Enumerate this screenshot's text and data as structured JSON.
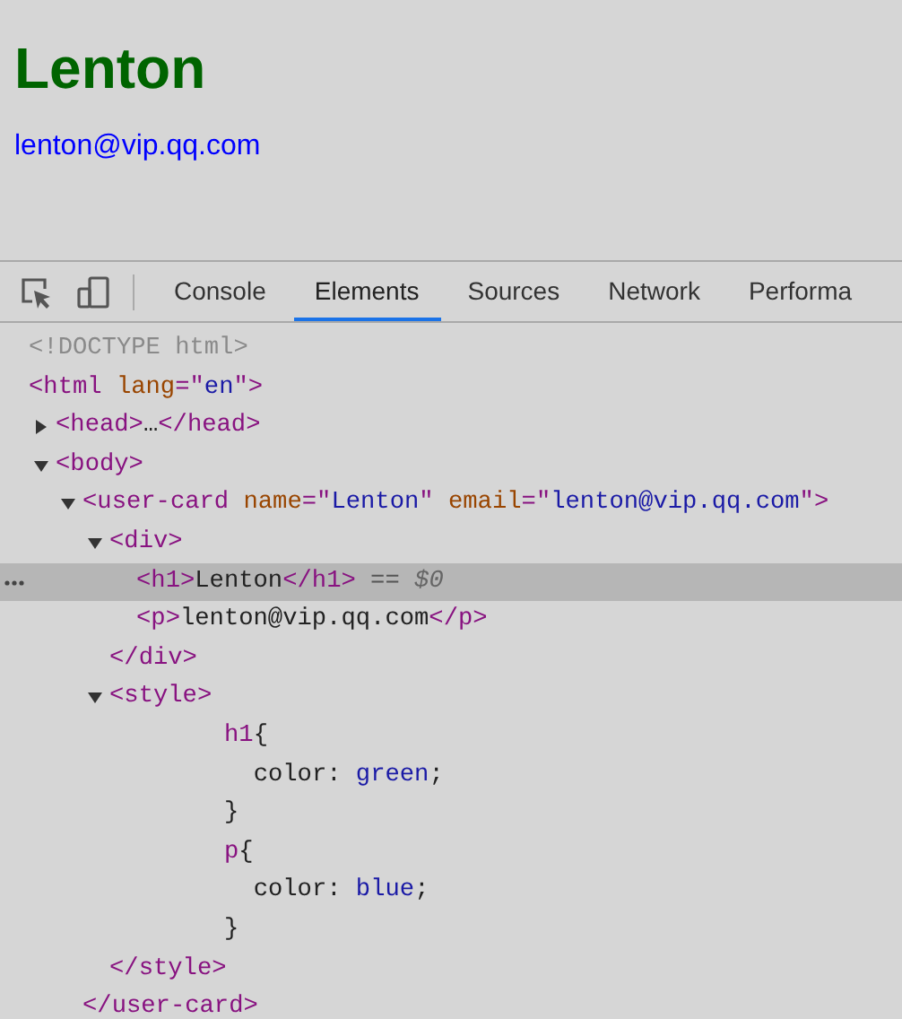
{
  "page": {
    "heading": "Lenton",
    "email": "lenton@vip.qq.com"
  },
  "devtools": {
    "tabs": [
      {
        "label": "Console",
        "selected": false
      },
      {
        "label": "Elements",
        "selected": true
      },
      {
        "label": "Sources",
        "selected": false
      },
      {
        "label": "Network",
        "selected": false
      },
      {
        "label": "Performa",
        "selected": false
      }
    ],
    "dom_tree": [
      {
        "selected": false,
        "tokens": [
          {
            "kind": "doctype",
            "text": "<!DOCTYPE html>"
          }
        ]
      },
      {
        "selected": false,
        "tokens": [
          {
            "kind": "tag",
            "text": "<html "
          },
          {
            "kind": "attr",
            "text": "lang"
          },
          {
            "kind": "tag",
            "text": "=\""
          },
          {
            "kind": "value",
            "text": "en"
          },
          {
            "kind": "tag",
            "text": "\">"
          }
        ],
        "children": [
          {
            "selected": false,
            "expanded": false,
            "tokens": [
              {
                "kind": "tag",
                "text": "<head>"
              },
              {
                "kind": "text",
                "text": "…"
              },
              {
                "kind": "tag",
                "text": "</head>"
              }
            ]
          },
          {
            "selected": false,
            "expanded": true,
            "tokens": [
              {
                "kind": "tag",
                "text": "<body>"
              }
            ],
            "children": [
              {
                "selected": false,
                "expanded": true,
                "tokens": [
                  {
                    "kind": "tag",
                    "text": "<user-card "
                  },
                  {
                    "kind": "attr",
                    "text": "name"
                  },
                  {
                    "kind": "tag",
                    "text": "=\""
                  },
                  {
                    "kind": "value",
                    "text": "Lenton"
                  },
                  {
                    "kind": "tag",
                    "text": "\" "
                  },
                  {
                    "kind": "attr",
                    "text": "email"
                  },
                  {
                    "kind": "tag",
                    "text": "=\""
                  },
                  {
                    "kind": "value",
                    "text": "lenton@vip.qq.com"
                  },
                  {
                    "kind": "tag",
                    "text": "\">"
                  }
                ],
                "children": [
                  {
                    "selected": false,
                    "expanded": true,
                    "tokens": [
                      {
                        "kind": "tag",
                        "text": "<div>"
                      }
                    ],
                    "children": [
                      {
                        "selected": true,
                        "tokens": [
                          {
                            "kind": "tag",
                            "text": "<h1>"
                          },
                          {
                            "kind": "text",
                            "text": "Lenton"
                          },
                          {
                            "kind": "tag",
                            "text": "</h1>"
                          },
                          {
                            "kind": "hint",
                            "text": " == "
                          },
                          {
                            "kind": "hintvar",
                            "text": "$0"
                          }
                        ]
                      },
                      {
                        "selected": false,
                        "tokens": [
                          {
                            "kind": "tag",
                            "text": "<p>"
                          },
                          {
                            "kind": "text",
                            "text": "lenton@vip.qq.com"
                          },
                          {
                            "kind": "tag",
                            "text": "</p>"
                          }
                        ]
                      }
                    ],
                    "closing": [
                      {
                        "kind": "tag",
                        "text": "</div>"
                      }
                    ]
                  },
                  {
                    "selected": false,
                    "expanded": true,
                    "tokens": [
                      {
                        "kind": "tag",
                        "text": "<style>"
                      }
                    ],
                    "children": [
                      {
                        "selected": false,
                        "css": true,
                        "tokens": [
                          {
                            "kind": "selector",
                            "text": "h1"
                          },
                          {
                            "kind": "text",
                            "text": "{"
                          }
                        ]
                      },
                      {
                        "selected": false,
                        "css": true,
                        "tokens": [
                          {
                            "kind": "text",
                            "text": "  color: "
                          },
                          {
                            "kind": "cssvalue",
                            "text": "green"
                          },
                          {
                            "kind": "text",
                            "text": ";"
                          }
                        ]
                      },
                      {
                        "selected": false,
                        "css": true,
                        "tokens": [
                          {
                            "kind": "text",
                            "text": "}"
                          }
                        ]
                      },
                      {
                        "selected": false,
                        "css": true,
                        "tokens": [
                          {
                            "kind": "selector",
                            "text": "p"
                          },
                          {
                            "kind": "text",
                            "text": "{"
                          }
                        ]
                      },
                      {
                        "selected": false,
                        "css": true,
                        "tokens": [
                          {
                            "kind": "text",
                            "text": "  color: "
                          },
                          {
                            "kind": "cssvalue",
                            "text": "blue"
                          },
                          {
                            "kind": "text",
                            "text": ";"
                          }
                        ]
                      },
                      {
                        "selected": false,
                        "css": true,
                        "tokens": [
                          {
                            "kind": "text",
                            "text": "}"
                          }
                        ]
                      }
                    ],
                    "closing": [
                      {
                        "kind": "tag",
                        "text": "</style>"
                      }
                    ]
                  }
                ],
                "closing": [
                  {
                    "kind": "tag",
                    "text": "</user-card>"
                  }
                ]
              }
            ]
          }
        ]
      }
    ]
  }
}
